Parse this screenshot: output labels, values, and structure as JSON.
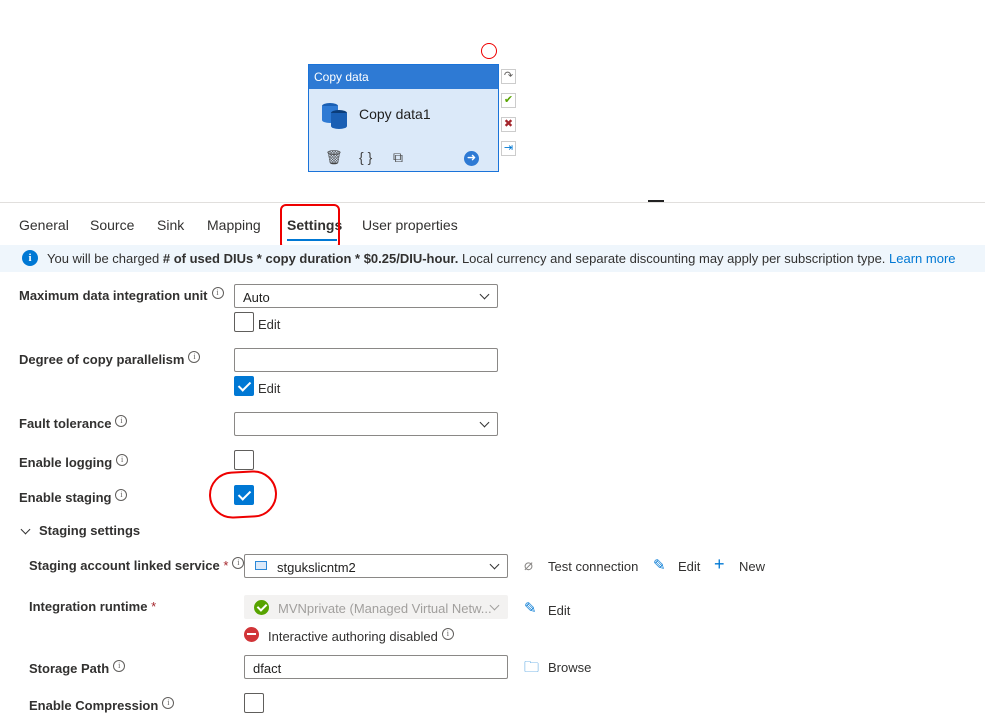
{
  "activity": {
    "type_label": "Copy data",
    "name": "Copy data1",
    "tools": {
      "delete": "🗑",
      "code": "{ }",
      "copy": "⧉",
      "go": "➜"
    }
  },
  "tabs": [
    {
      "label": "General"
    },
    {
      "label": "Source"
    },
    {
      "label": "Sink"
    },
    {
      "label": "Mapping"
    },
    {
      "label": "Settings"
    },
    {
      "label": "User properties"
    }
  ],
  "banner": {
    "pre": "You will be charged ",
    "bold": "# of used DIUs * copy duration * $0.25/DIU-hour.",
    "post": " Local currency and separate discounting may apply per subscription type. ",
    "link": "Learn more"
  },
  "settings": {
    "max_diu": {
      "label": "Maximum data integration unit",
      "value": "Auto",
      "edit_label": "Edit",
      "edit_checked": false
    },
    "parallelism": {
      "label": "Degree of copy parallelism",
      "value": "",
      "edit_label": "Edit",
      "edit_checked": true
    },
    "fault_tolerance": {
      "label": "Fault tolerance",
      "value": ""
    },
    "enable_logging": {
      "label": "Enable logging",
      "checked": false
    },
    "enable_staging": {
      "label": "Enable staging",
      "checked": true
    }
  },
  "staging": {
    "section_label": "Staging settings",
    "linked_service": {
      "label": "Staging account linked service",
      "required": "*",
      "value": "stgukslicntm2",
      "test_connection": "Test connection",
      "edit": "Edit",
      "new": "New"
    },
    "integration_runtime": {
      "label": "Integration runtime",
      "required": "*",
      "value": "MVNprivate (Managed Virtual Netw...",
      "edit": "Edit",
      "status": "Interactive authoring disabled"
    },
    "storage_path": {
      "label": "Storage Path",
      "value": "dfact",
      "browse": "Browse"
    },
    "compression": {
      "label": "Enable Compression",
      "checked": false
    }
  },
  "colors": {
    "accent": "#0078d4",
    "annotation": "#e00000",
    "activity_header": "#2e7ad4"
  }
}
